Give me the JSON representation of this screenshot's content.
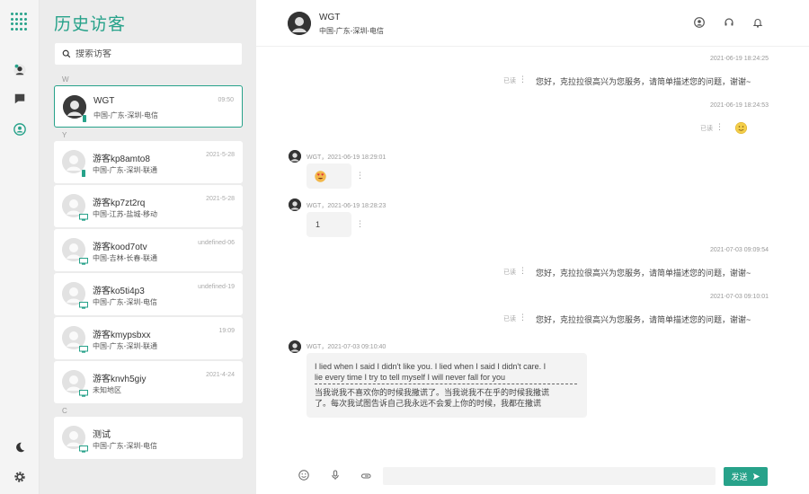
{
  "sidebar": {
    "title": "历史访客",
    "search_placeholder": "搜索访客"
  },
  "groups": [
    {
      "letter": "W"
    },
    {
      "letter": "Y"
    },
    {
      "letter": "C"
    }
  ],
  "visitors": [
    {
      "name": "WGT",
      "location": "中国-广东-深圳-电信",
      "date": "09:50",
      "device": "mobile",
      "active": true
    },
    {
      "name": "游客kp8amto8",
      "location": "中国-广东-深圳-联通",
      "date": "2021-5-28",
      "device": "mobile"
    },
    {
      "name": "游客kp7zt2rq",
      "location": "中国-江苏-盐城-移动",
      "date": "2021-5-28",
      "device": "desktop"
    },
    {
      "name": "游客kood7otv",
      "location": "中国-吉林-长春-联通",
      "date": "undefined-06",
      "device": "desktop"
    },
    {
      "name": "游客ko5ti4p3",
      "location": "中国-广东-深圳-电信",
      "date": "undefined-19",
      "device": "desktop"
    },
    {
      "name": "游客kmypsbxx",
      "location": "中国-广东-深圳-联通",
      "date": "19:09",
      "device": "desktop"
    },
    {
      "name": "游客knvh5giy",
      "location": "未知地区",
      "date": "2021-4-24",
      "device": "desktop"
    },
    {
      "name": "测试",
      "location": "中国-广东-深圳-电信",
      "date": "",
      "device": "desktop"
    }
  ],
  "chat": {
    "header": {
      "name": "WGT",
      "location": "中国-广东-深圳-电信"
    },
    "messages": [
      {
        "time": "2021-06-19 18:24:25",
        "status": "已读",
        "text": "您好，克拉拉很高兴为您服务，请简单描述您的问题，谢谢~"
      },
      {
        "time": "2021-06-19 18:24:53",
        "status": "已读"
      },
      {
        "meta": "WGT，2021-06-19 18:29:01"
      },
      {
        "meta": "WGT，2021-06-19 18:28:23",
        "text": "1"
      },
      {
        "time": "2021-07-03 09:09:54",
        "status": "已读",
        "text": "您好，克拉拉很高兴为您服务，请简单描述您的问题，谢谢~"
      },
      {
        "time": "2021-07-03 09:10:01",
        "status": "已读",
        "text": "您好，克拉拉很高兴为您服务，请简单描述您的问题，谢谢~"
      },
      {
        "meta": "WGT，2021-07-03 09:10:40",
        "en_line1": "I lied when I said I didn't like you. I lied when I said I didn't care. I",
        "en_line2": "lie every time I try to tell myself I will never fall for you",
        "zh_line1": "当我说我不喜欢你的时候我撒谎了。当我说我不在乎的时候我撒谎",
        "zh_line2": "了。每次我试图告诉自己我永远不会爱上你的时候，我都在撒谎"
      }
    ]
  },
  "footer": {
    "send_label": "发送"
  },
  "colors": {
    "accent": "#27a28a"
  }
}
